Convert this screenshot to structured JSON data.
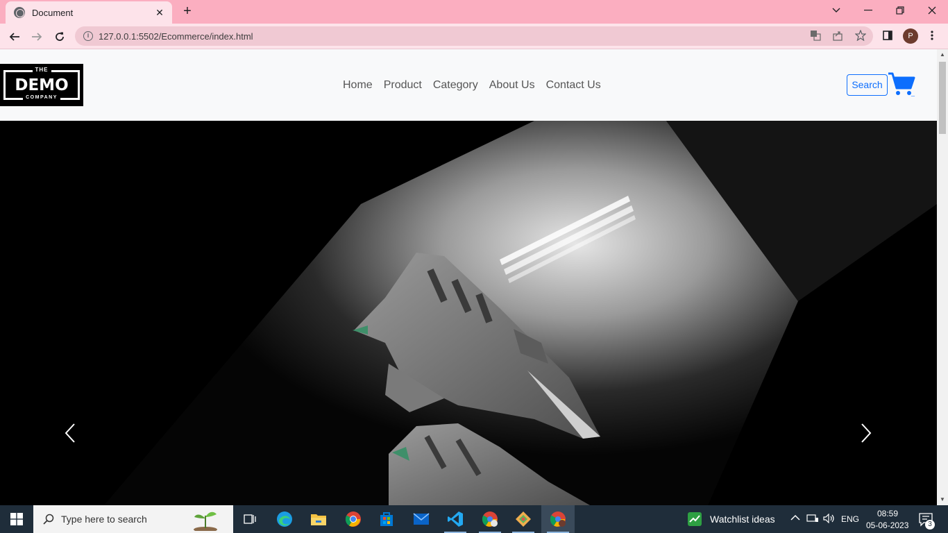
{
  "browser": {
    "tab_title": "Document",
    "url": "127.0.0.1:5502/Ecommerce/index.html",
    "profile_initial": "P"
  },
  "site": {
    "logo": {
      "top": "THE",
      "main": "DEMO",
      "bottom": "COMPANY"
    },
    "nav": [
      "Home",
      "Product",
      "Category",
      "About Us",
      "Contact Us"
    ],
    "search_label": "Search",
    "cart_count": "_",
    "colors": {
      "accent": "#0d6efd",
      "nav_text": "#555555",
      "page_bg": "#f8f9fa"
    }
  },
  "hero": {
    "image": "grey-sneakers-in-spotlight",
    "prev_icon": "chevron-left-icon",
    "next_icon": "chevron-right-icon"
  },
  "taskbar": {
    "search_placeholder": "Type here to search",
    "watchlist": "Watchlist ideas",
    "lang": "ENG",
    "time": "08:59",
    "date": "05-06-2023",
    "notifications": "3"
  }
}
